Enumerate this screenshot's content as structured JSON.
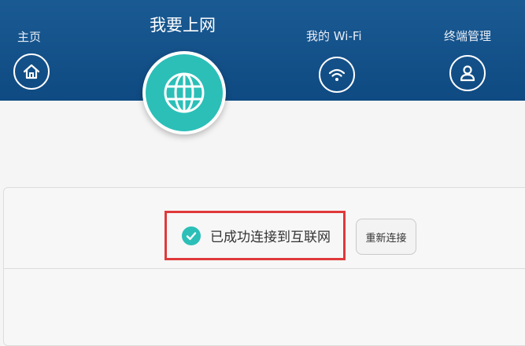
{
  "nav": {
    "home": {
      "label": "主页",
      "icon": "home-icon"
    },
    "internet": {
      "label": "我要上网",
      "icon": "globe-icon"
    },
    "wifi": {
      "label": "我的 Wi-Fi",
      "icon": "wifi-icon"
    },
    "terminal": {
      "label": "终端管理",
      "icon": "user-icon"
    }
  },
  "status": {
    "text": "已成功连接到互联网",
    "icon": "check-circle-icon"
  },
  "reconnect_label": "重新连接",
  "colors": {
    "header": "#0f4a82",
    "accent": "#2bbfb8",
    "highlight": "#e0393b"
  }
}
